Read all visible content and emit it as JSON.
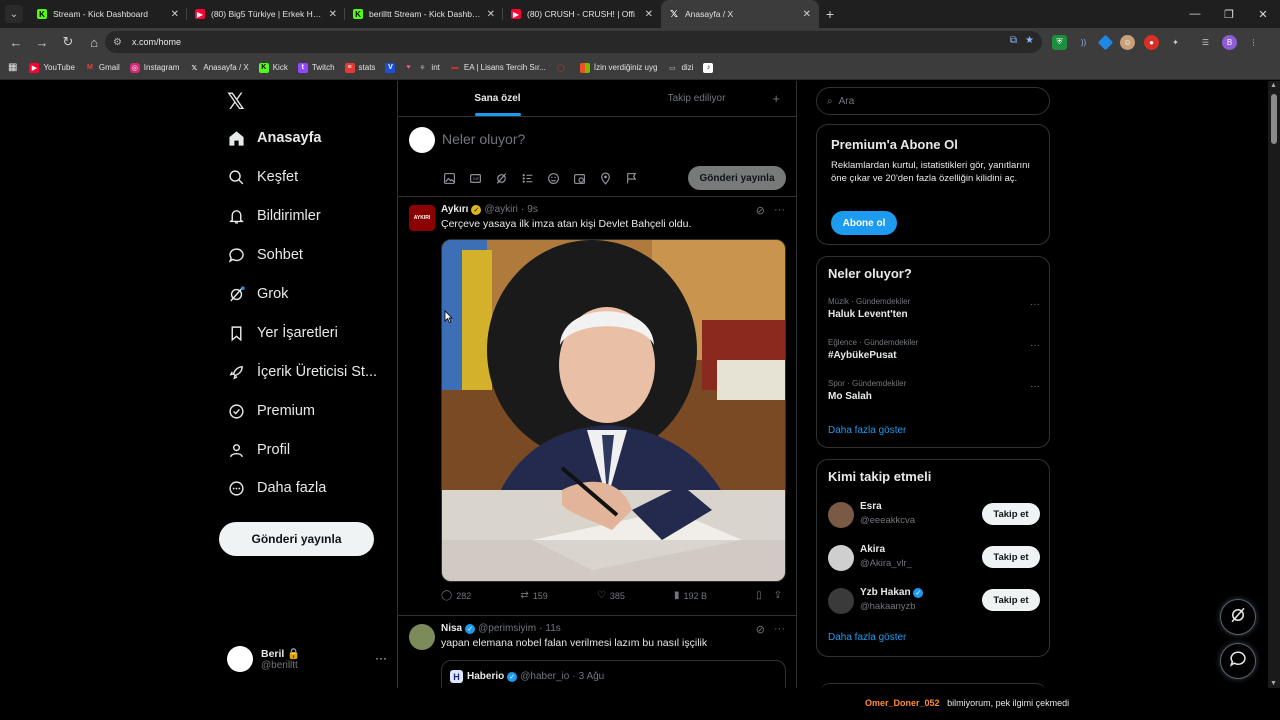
{
  "browser": {
    "tabs": [
      {
        "title": "Stream - Kick Dashboard",
        "favicon": "kick-icon",
        "active": false
      },
      {
        "title": "(80) Big5 Türkiye | Erkek Hazırlık",
        "favicon": "youtube-icon",
        "active": false
      },
      {
        "title": "berilltt Stream - Kick Dashboard",
        "favicon": "kick-icon",
        "active": false
      },
      {
        "title": "(80) CRUSH - CRUSH! | Offi",
        "favicon": "youtube-icon",
        "active": false
      },
      {
        "title": "Anasayfa / X",
        "favicon": "x-icon",
        "active": true
      }
    ],
    "url": "x.com/home",
    "profile_initial": "B",
    "bookmarks": [
      {
        "label": "YouTube",
        "icon": "youtube-icon"
      },
      {
        "label": "Gmail",
        "icon": "gmail-icon"
      },
      {
        "label": "Instagram",
        "icon": "instagram-icon"
      },
      {
        "label": "Anasayfa / X",
        "icon": "x-icon"
      },
      {
        "label": "Kick",
        "icon": "kick-icon"
      },
      {
        "label": "Twitch",
        "icon": "twitch-icon"
      },
      {
        "label": "stats",
        "icon": "stats-icon"
      },
      {
        "label": "",
        "icon": "valorant-icon"
      },
      {
        "label": "int",
        "icon": "heart-icon"
      },
      {
        "label": "EA | Lisans Tercih Sır...",
        "icon": "ea-icon"
      },
      {
        "label": "",
        "icon": "circle-icon"
      },
      {
        "label": "İzin verdiğiniz uyg",
        "icon": "microsoft-icon"
      },
      {
        "label": "dizi",
        "icon": "folder-icon"
      },
      {
        "label": "",
        "icon": "tiktok-icon"
      }
    ]
  },
  "nav": {
    "items": [
      {
        "label": "Anasayfa",
        "icon": "home-icon"
      },
      {
        "label": "Keşfet",
        "icon": "search-icon"
      },
      {
        "label": "Bildirimler",
        "icon": "bell-icon"
      },
      {
        "label": "Sohbet",
        "icon": "chat-icon"
      },
      {
        "label": "Grok",
        "icon": "grok-icon"
      },
      {
        "label": "Yer İşaretleri",
        "icon": "bookmark-icon"
      },
      {
        "label": "İçerik Üreticisi St...",
        "icon": "rocket-icon"
      },
      {
        "label": "Premium",
        "icon": "verified-icon"
      },
      {
        "label": "Profil",
        "icon": "person-icon"
      },
      {
        "label": "Daha fazla",
        "icon": "more-circle-icon"
      }
    ],
    "post_button": "Gönderi yayınla",
    "account": {
      "name": "Beril",
      "handle": "@berilltt"
    }
  },
  "feed": {
    "tabs": [
      "Sana özel",
      "Takip ediliyor"
    ],
    "composer_placeholder": "Neler oluyor?",
    "composer_button": "Gönderi yayınla",
    "posts": [
      {
        "author": "Aykırı",
        "handle": "@aykiri",
        "time": "9s",
        "avatar_text": "AYKIRI",
        "text": "Çerçeve yasaya ilk imza atan kişi Devlet Bahçeli oldu.",
        "stats": {
          "replies": "282",
          "reposts": "159",
          "likes": "385",
          "views": "192 B"
        }
      },
      {
        "author": "Nisa",
        "handle": "@perimsiyim",
        "time": "11s",
        "text": "yapan elemana nobel falan verilmesi lazım bu nasıl işçilik",
        "quote": {
          "author": "Haberio",
          "handle": "@haber_io",
          "time": "3 Ağu",
          "logo_letter": "H"
        }
      }
    ]
  },
  "sidebar": {
    "search_placeholder": "Ara",
    "premium": {
      "title": "Premium'a Abone Ol",
      "text": "Reklamlardan kurtul, istatistikleri gör, yanıtlarını öne çıkar ve 20'den fazla özelliğin kilidini aç.",
      "button": "Abone ol"
    },
    "trends": {
      "title": "Neler oluyor?",
      "items": [
        {
          "category": "Müzik · Gündemdekiler",
          "name": "Haluk Levent'ten"
        },
        {
          "category": "Eğlence · Gündemdekiler",
          "name": "#AybükePusat"
        },
        {
          "category": "Spor · Gündemdekiler",
          "name": "Mo Salah"
        }
      ],
      "more": "Daha fazla göster"
    },
    "who_to_follow": {
      "title": "Kimi takip etmeli",
      "users": [
        {
          "name": "Esra",
          "handle": "@eeeakkcva",
          "verified": false
        },
        {
          "name": "Akira",
          "handle": "@Akira_vlr_",
          "verified": false
        },
        {
          "name": "Yzb Hakan",
          "handle": "@hakaanyzb",
          "verified": true
        }
      ],
      "follow_label": "Takip et",
      "more": "Daha fazla göster"
    }
  },
  "chat_overlay": {
    "user": "Omer_Doner_052",
    "message": "bilmiyorum, pek ilgimi çekmedi"
  },
  "colors": {
    "accent": "#1d9bf0",
    "background": "#000000",
    "border": "#2f3336",
    "gold_badge": "#e2b719",
    "kick_green": "#53fc18",
    "youtube_red": "#ff0033"
  }
}
